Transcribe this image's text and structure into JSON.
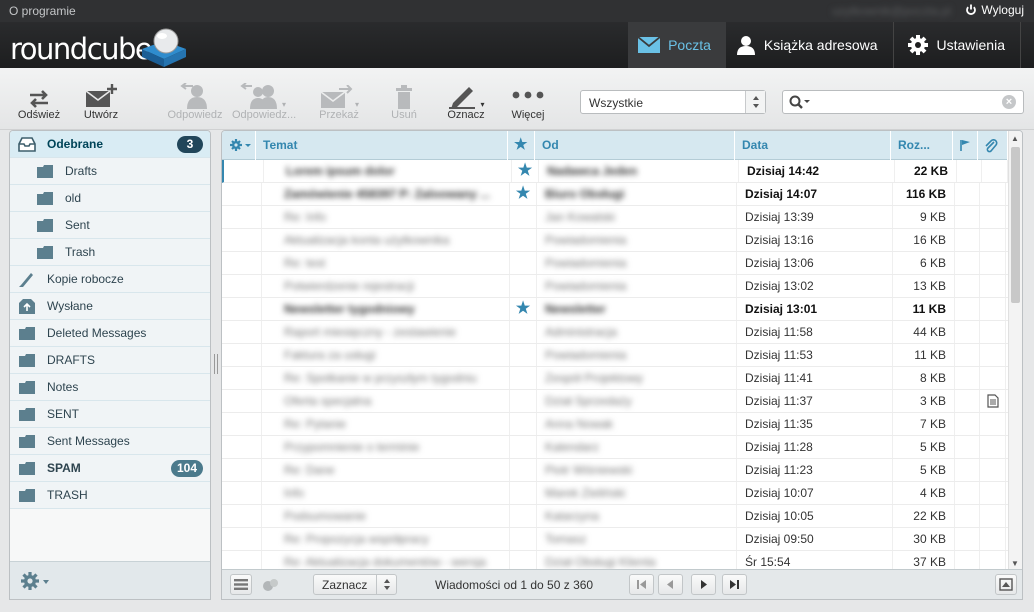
{
  "topbar": {
    "about": "O programie",
    "user": "uzytkownik@poczta.pl",
    "logout": "Wyloguj"
  },
  "brand": {
    "logo": "roundcube"
  },
  "nav": [
    {
      "label": "Poczta",
      "icon": "envelope-icon",
      "active": true
    },
    {
      "label": "Książka adresowa",
      "icon": "contact-icon",
      "active": false
    },
    {
      "label": "Ustawienia",
      "icon": "gear-icon",
      "active": false
    }
  ],
  "toolbar": {
    "refresh": "Odśwież",
    "compose": "Utwórz",
    "reply": "Odpowiedz",
    "reply_all": "Odpowiedz...",
    "forward": "Przekaż",
    "delete": "Usuń",
    "mark": "Oznacz",
    "more": "Więcej"
  },
  "filter": {
    "selected": "Wszystkie"
  },
  "search": {
    "placeholder": ""
  },
  "folders": [
    {
      "name": "Odebrane",
      "icon": "inbox-icon",
      "level": 0,
      "badge": "3",
      "selected": true,
      "bold": true
    },
    {
      "name": "Drafts",
      "icon": "folder-icon",
      "level": 1
    },
    {
      "name": "old",
      "icon": "folder-icon",
      "level": 1
    },
    {
      "name": "Sent",
      "icon": "folder-icon",
      "level": 1
    },
    {
      "name": "Trash",
      "icon": "folder-icon",
      "level": 1
    },
    {
      "name": "Kopie robocze",
      "icon": "pencil-icon",
      "level": 0
    },
    {
      "name": "Wysłane",
      "icon": "sent-icon",
      "level": 0
    },
    {
      "name": "Deleted Messages",
      "icon": "folder-icon",
      "level": 0
    },
    {
      "name": "DRAFTS",
      "icon": "folder-icon",
      "level": 0
    },
    {
      "name": "Notes",
      "icon": "folder-icon",
      "level": 0
    },
    {
      "name": "SENT",
      "icon": "folder-icon",
      "level": 0
    },
    {
      "name": "Sent Messages",
      "icon": "folder-icon",
      "level": 0
    },
    {
      "name": "SPAM",
      "icon": "folder-icon",
      "level": 0,
      "badge": "104",
      "bold": true
    },
    {
      "name": "TRASH",
      "icon": "folder-icon",
      "level": 0
    }
  ],
  "list": {
    "columns": {
      "subject": "Temat",
      "from": "Od",
      "date": "Data",
      "size": "Roz..."
    },
    "rows": [
      {
        "subject": "Lorem ipsum dolor",
        "from": "Nadawca Jeden",
        "date": "Dzisiaj 14:42",
        "size": "22 KB",
        "unread": true,
        "flagged": true,
        "selected": true
      },
      {
        "subject": "Zamówienie 458397 P: Zaloowany ...",
        "from": "Biuro Obsługi",
        "date": "Dzisiaj 14:07",
        "size": "116 KB",
        "unread": true,
        "flagged": true
      },
      {
        "subject": "Re: Info",
        "from": "Jan Kowalski",
        "date": "Dzisiaj 13:39",
        "size": "9 KB"
      },
      {
        "subject": "Aktualizacja konta użytkownika",
        "from": "Powiadomienia",
        "date": "Dzisiaj 13:16",
        "size": "16 KB"
      },
      {
        "subject": "Re: test",
        "from": "Powiadomienia",
        "date": "Dzisiaj 13:06",
        "size": "6 KB"
      },
      {
        "subject": "Potwierdzenie rejestracji",
        "from": "Powiadomienia",
        "date": "Dzisiaj 13:02",
        "size": "13 KB"
      },
      {
        "subject": "Newsletter tygodniowy",
        "from": "Newsletter",
        "date": "Dzisiaj 13:01",
        "size": "11 KB",
        "unread": true,
        "flagged": true
      },
      {
        "subject": "Raport miesięczny - zestawienie",
        "from": "Administracja",
        "date": "Dzisiaj 11:58",
        "size": "44 KB"
      },
      {
        "subject": "Faktura za usługi",
        "from": "Powiadomienia",
        "date": "Dzisiaj 11:53",
        "size": "11 KB"
      },
      {
        "subject": "Re: Spotkanie w przyszłym tygodniu",
        "from": "Zespół Projektowy",
        "date": "Dzisiaj 11:41",
        "size": "8 KB"
      },
      {
        "subject": "Oferta specjalna",
        "from": "Dział Sprzedaży",
        "date": "Dzisiaj 11:37",
        "size": "3 KB",
        "attachment": true
      },
      {
        "subject": "Re: Pytanie",
        "from": "Anna Nowak",
        "date": "Dzisiaj 11:35",
        "size": "7 KB"
      },
      {
        "subject": "Przypomnienie o terminie",
        "from": "Kalendarz",
        "date": "Dzisiaj 11:28",
        "size": "5 KB"
      },
      {
        "subject": "Re: Dane",
        "from": "Piotr Wiśniewski",
        "date": "Dzisiaj 11:23",
        "size": "5 KB"
      },
      {
        "subject": "Info",
        "from": "Marek Zieliński",
        "date": "Dzisiaj 10:07",
        "size": "4 KB",
        "replied": true
      },
      {
        "subject": "Podsumowanie",
        "from": "Katarzyna",
        "date": "Dzisiaj 10:05",
        "size": "22 KB"
      },
      {
        "subject": "Re: Propozycja współpracy",
        "from": "Tomasz",
        "date": "Dzisiaj 09:50",
        "size": "30 KB"
      },
      {
        "subject": "Re: Aktualizacja dokumentów - wersja",
        "from": "Dział Obsługi Klienta",
        "date": "Śr 15:54",
        "size": "37 KB"
      }
    ]
  },
  "footer": {
    "select_label": "Zaznacz",
    "count_text": "Wiadomości od 1 do 50 z 360"
  }
}
